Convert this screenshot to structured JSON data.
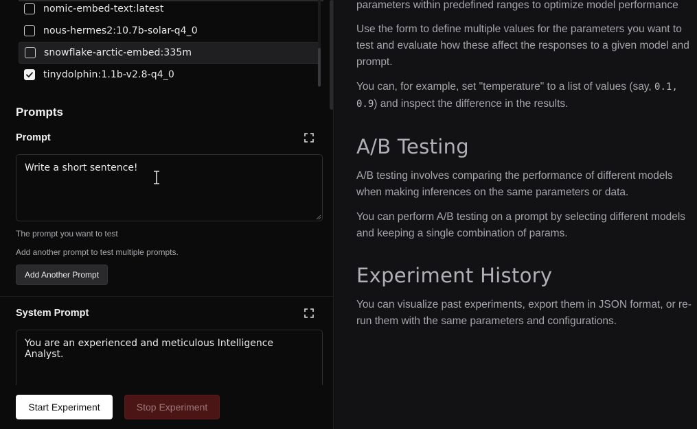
{
  "models": [
    {
      "label": "nomic-embed-text:latest",
      "checked": false
    },
    {
      "label": "nous-hermes2:10.7b-solar-q4_0",
      "checked": false
    },
    {
      "label": "snowflake-arctic-embed:335m",
      "checked": false
    },
    {
      "label": "tinydolphin:1.1b-v2.8-q4_0",
      "checked": true
    }
  ],
  "prompts": {
    "section_title": "Prompts",
    "prompt_label": "Prompt",
    "prompt_value": "Write a short sentence!",
    "prompt_helper": "The prompt you want to test",
    "add_helper": "Add another prompt to test multiple prompts.",
    "add_button": "Add Another Prompt",
    "system_label": "System Prompt",
    "system_value": "You are an experienced and meticulous Intelligence Analyst."
  },
  "actions": {
    "start": "Start Experiment",
    "stop": "Stop Experiment"
  },
  "docs": {
    "p1": "parameters within predefined ranges to optimize model performance",
    "p2a": "Use the form to define multiple values for the parameters you want to",
    "p2b": "test and evaluate how these affect the responses to a given model and",
    "p2c": "prompt.",
    "p3a_pre": "You can, for example, set \"temperature\" to a list of values (say, ",
    "p3a_code": "0.1,",
    "p3b_code": "0.9",
    "p3b_post": ") and inspect the difference in the results.",
    "h_ab": "A/B Testing",
    "p4a": "A/B testing involves comparing the performance of different models",
    "p4b": "when making inferences on the same parameters or data.",
    "p5a": "You can perform A/B testing on a prompt by selecting different models",
    "p5b": "and keeping a single combination of params.",
    "h_hist": "Experiment History",
    "p6a": "You can visualize past experiments, export them in JSON format, or re-",
    "p6b": "run them with the same parameters and configurations."
  }
}
